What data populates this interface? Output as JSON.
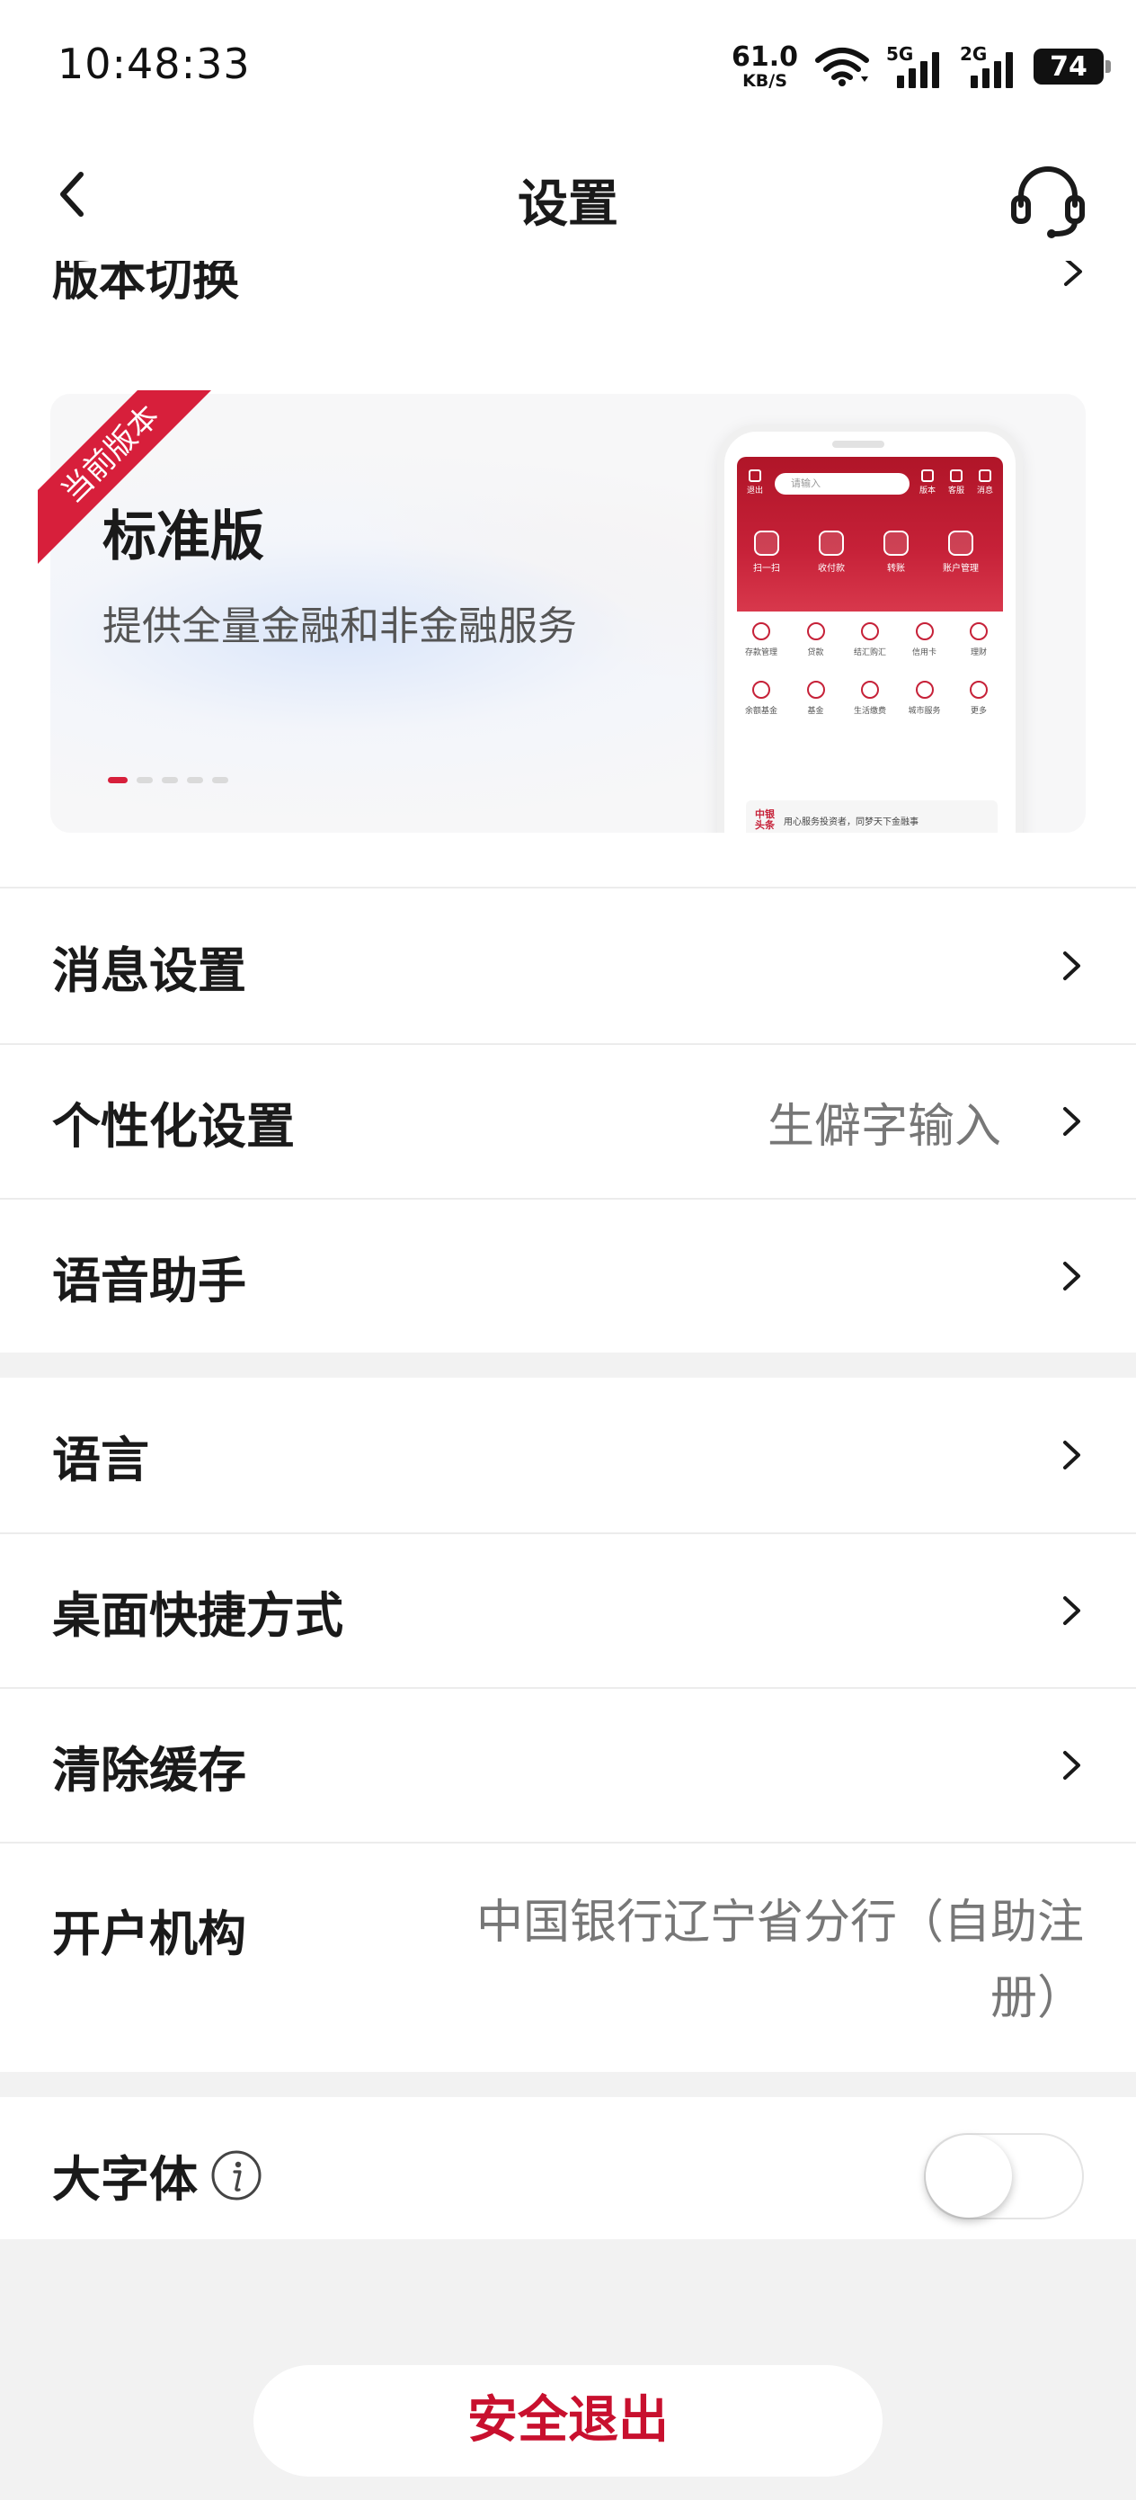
{
  "status_bar": {
    "time": "10:48:33",
    "net_speed_value": "61.0",
    "net_speed_unit": "KB/S",
    "sim1": "5G",
    "sim2": "2G",
    "battery": "74"
  },
  "header": {
    "title": "设置"
  },
  "version": {
    "section_label": "版本切换",
    "ribbon": "当前版本",
    "card_title": "标准版",
    "card_desc": "提供全量金融和非金融服务",
    "carousel_count": 5,
    "carousel_active": 0,
    "preview": {
      "search_placeholder": "请输入",
      "top_icons": [
        "退出",
        "版本",
        "客服",
        "消息"
      ],
      "quick": [
        "扫一扫",
        "收付款",
        "转账",
        "账户管理"
      ],
      "grid": [
        [
          "存款管理",
          "贷款",
          "结汇购汇",
          "信用卡",
          "理财"
        ],
        [
          "余额基金",
          "基金",
          "生活缴费",
          "城市服务",
          "更多"
        ]
      ],
      "news_brand": [
        "中银",
        "头条"
      ],
      "news_text": "用心服务投资者，同梦天下金融事"
    }
  },
  "settings_group1": [
    {
      "label": "消息设置",
      "value": ""
    },
    {
      "label": "个性化设置",
      "value": "生僻字输入"
    },
    {
      "label": "语音助手",
      "value": ""
    }
  ],
  "settings_group2": [
    {
      "label": "语言",
      "value": ""
    },
    {
      "label": "桌面快捷方式",
      "value": ""
    },
    {
      "label": "清除缓存",
      "value": ""
    }
  ],
  "account_branch": {
    "label": "开户机构",
    "value_line1": "中国银行辽宁省分行（自助注",
    "value_line2": "册）"
  },
  "large_font": {
    "label": "大字体",
    "enabled": false
  },
  "logout": {
    "label": "安全退出"
  },
  "colors": {
    "accent": "#d71f3b",
    "logout_text": "#c8102e",
    "background": "#f2f2f2"
  }
}
